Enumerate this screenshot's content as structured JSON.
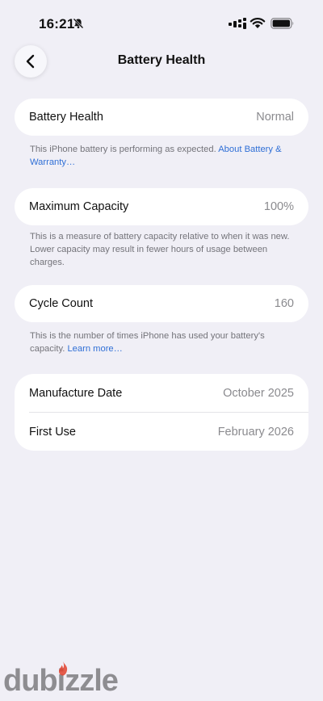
{
  "status_bar": {
    "time": "16:21",
    "icons": [
      "bell-slash-icon",
      "cellular-signal-icon",
      "wifi-icon",
      "battery-icon"
    ]
  },
  "nav": {
    "back_icon": "chevron-left-icon",
    "title": "Battery Health"
  },
  "sections": {
    "health": {
      "label": "Battery Health",
      "value": "Normal",
      "note": "This iPhone battery is performing as expected.",
      "note_link": "About Battery & Warranty…"
    },
    "capacity": {
      "label": "Maximum Capacity",
      "value": "100%",
      "note": "This is a measure of battery capacity relative to when it was new. Lower capacity may result in fewer hours of usage between charges."
    },
    "cycles": {
      "label": "Cycle Count",
      "value": "160",
      "note": "This is the number of times iPhone has used your battery's capacity.",
      "note_link": "Learn more…"
    },
    "dates": {
      "manufacture_label": "Manufacture Date",
      "manufacture_value": "October 2025",
      "first_use_label": "First Use",
      "first_use_value": "February 2026"
    }
  },
  "watermark": {
    "text": "dubizzle"
  },
  "colors": {
    "background": "#f0eff6",
    "card": "#ffffff",
    "link": "#2f6fd6",
    "secondary_text": "#8a8a8e",
    "watermark_flame": "#e2422e"
  }
}
